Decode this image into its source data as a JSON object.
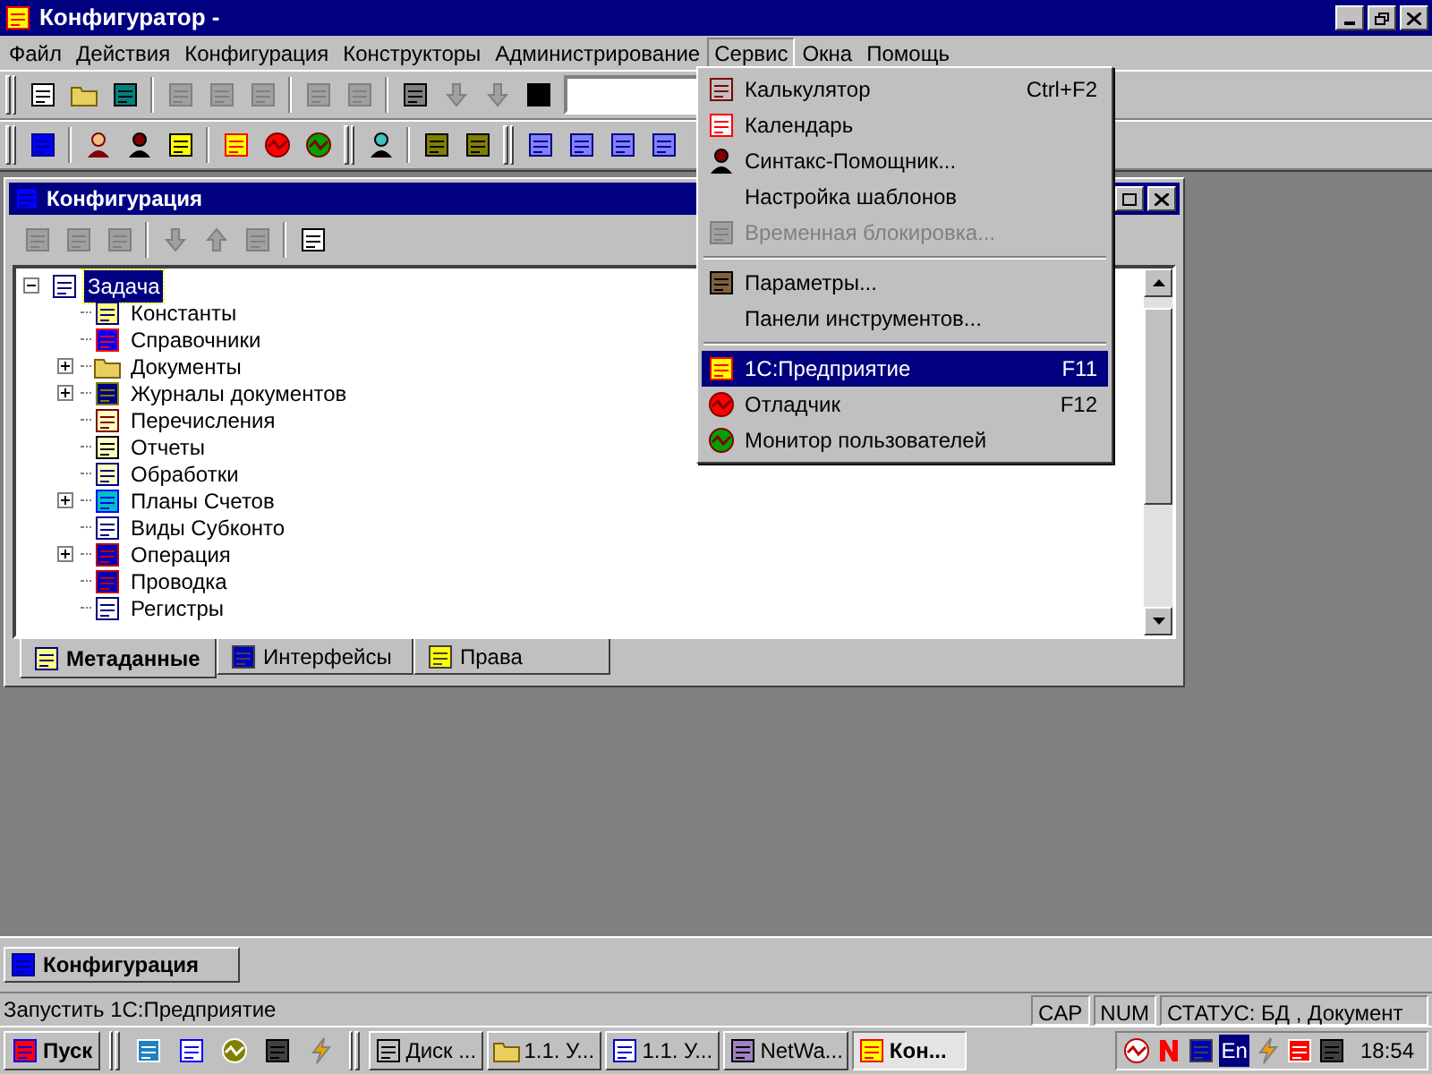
{
  "window": {
    "title": "Конфигуратор -"
  },
  "menu_bar": [
    {
      "label": "Файл",
      "selected": false
    },
    {
      "label": "Действия",
      "selected": false
    },
    {
      "label": "Конфигурация",
      "selected": false
    },
    {
      "label": "Конструкторы",
      "selected": false
    },
    {
      "label": "Администрирование",
      "selected": false
    },
    {
      "label": "Сервис",
      "selected": true
    },
    {
      "label": "Окна",
      "selected": false
    },
    {
      "label": "Помощь",
      "selected": false
    }
  ],
  "toolbar_1": {
    "groups": [
      [
        {
          "disabled": false
        },
        {
          "disabled": false
        },
        {
          "disabled": false
        }
      ],
      [
        {
          "disabled": true
        },
        {
          "disabled": true
        },
        {
          "disabled": true
        }
      ],
      [
        {
          "disabled": true
        },
        {
          "disabled": true
        }
      ],
      [
        {
          "disabled": false
        },
        {
          "disabled": true
        },
        {
          "disabled": true
        },
        {
          "disabled": false
        }
      ]
    ]
  },
  "toolbar_2": {
    "groups": [
      [
        {
          "disabled": false
        }
      ],
      [
        {
          "disabled": false
        },
        {
          "disabled": false
        },
        {
          "disabled": false
        }
      ],
      [
        {
          "disabled": false
        },
        {
          "disabled": false
        },
        {
          "disabled": false
        }
      ],
      [
        {
          "disabled": false
        }
      ],
      [
        {
          "disabled": false
        },
        {
          "disabled": false
        }
      ],
      [
        {
          "disabled": false
        },
        {
          "disabled": false
        },
        {
          "disabled": false
        },
        {
          "disabled": false
        }
      ]
    ]
  },
  "service_menu": {
    "items": [
      {
        "kind": "item",
        "label": "Калькулятор",
        "shortcut": "Ctrl+F2",
        "disabled": false,
        "selected": false
      },
      {
        "kind": "item",
        "label": "Календарь",
        "disabled": false,
        "selected": false
      },
      {
        "kind": "item",
        "label": "Синтакс-Помощник...",
        "disabled": false,
        "selected": false
      },
      {
        "kind": "item",
        "label": "Настройка шаблонов",
        "disabled": false,
        "selected": false
      },
      {
        "kind": "item",
        "label": "Временная блокировка...",
        "disabled": true,
        "selected": false
      },
      {
        "kind": "separator"
      },
      {
        "kind": "item",
        "label": "Параметры...",
        "disabled": false,
        "selected": false
      },
      {
        "kind": "item",
        "label": "Панели инструментов...",
        "disabled": false,
        "selected": false
      },
      {
        "kind": "separator"
      },
      {
        "kind": "item",
        "label": "1С:Предприятие",
        "shortcut": "F11",
        "disabled": false,
        "selected": true
      },
      {
        "kind": "item",
        "label": "Отладчик",
        "shortcut": "F12",
        "disabled": false,
        "selected": false
      },
      {
        "kind": "item",
        "label": "Монитор пользователей",
        "disabled": false,
        "selected": false
      }
    ]
  },
  "config_window": {
    "title": "Конфигурация",
    "toolbar": [
      [
        {
          "disabled": true
        },
        {
          "disabled": true
        },
        {
          "disabled": true
        }
      ],
      [
        {
          "disabled": true
        },
        {
          "disabled": true
        },
        {
          "disabled": true
        }
      ],
      [
        {
          "disabled": false
        }
      ]
    ],
    "tree": {
      "label": "Задача",
      "selected": true,
      "expanded": true,
      "children": [
        {
          "label": "Константы",
          "collapsed": false,
          "selected": false
        },
        {
          "label": "Справочники",
          "collapsed": false,
          "selected": false
        },
        {
          "label": "Документы",
          "collapsed": true,
          "selected": false
        },
        {
          "label": "Журналы документов",
          "collapsed": true,
          "selected": false
        },
        {
          "label": "Перечисления",
          "collapsed": false,
          "selected": false
        },
        {
          "label": "Отчеты",
          "collapsed": false,
          "selected": false
        },
        {
          "label": "Обработки",
          "collapsed": false,
          "selected": false
        },
        {
          "label": "Планы Счетов",
          "collapsed": true,
          "selected": false
        },
        {
          "label": "Виды Субконто",
          "collapsed": false,
          "selected": false
        },
        {
          "label": "Операция",
          "collapsed": true,
          "selected": false
        },
        {
          "label": "Проводка",
          "collapsed": false,
          "selected": false
        },
        {
          "label": "Регистры",
          "collapsed": false,
          "selected": false
        }
      ]
    },
    "tabs": [
      {
        "label": "Метаданные",
        "selected": true
      },
      {
        "label": "Интерфейсы",
        "selected": false
      },
      {
        "label": "Права",
        "selected": false
      }
    ]
  },
  "minimized_window": {
    "title": "Конфигурация"
  },
  "status_bar": {
    "message": "Запустить 1С:Предприятие",
    "panels": [
      "CAP",
      "NUM",
      "СТАТУС: БД , Документ"
    ]
  },
  "taskbar": {
    "start": "Пуск",
    "tasks": [
      {
        "label": "Диск ...",
        "selected": false
      },
      {
        "label": "1.1. У...",
        "selected": false
      },
      {
        "label": "1.1. У...",
        "selected": false
      },
      {
        "label": "NetWa...",
        "selected": false
      },
      {
        "label": "Кон...",
        "selected": true
      }
    ],
    "tray": {
      "language": "En",
      "clock": "18:54"
    }
  }
}
